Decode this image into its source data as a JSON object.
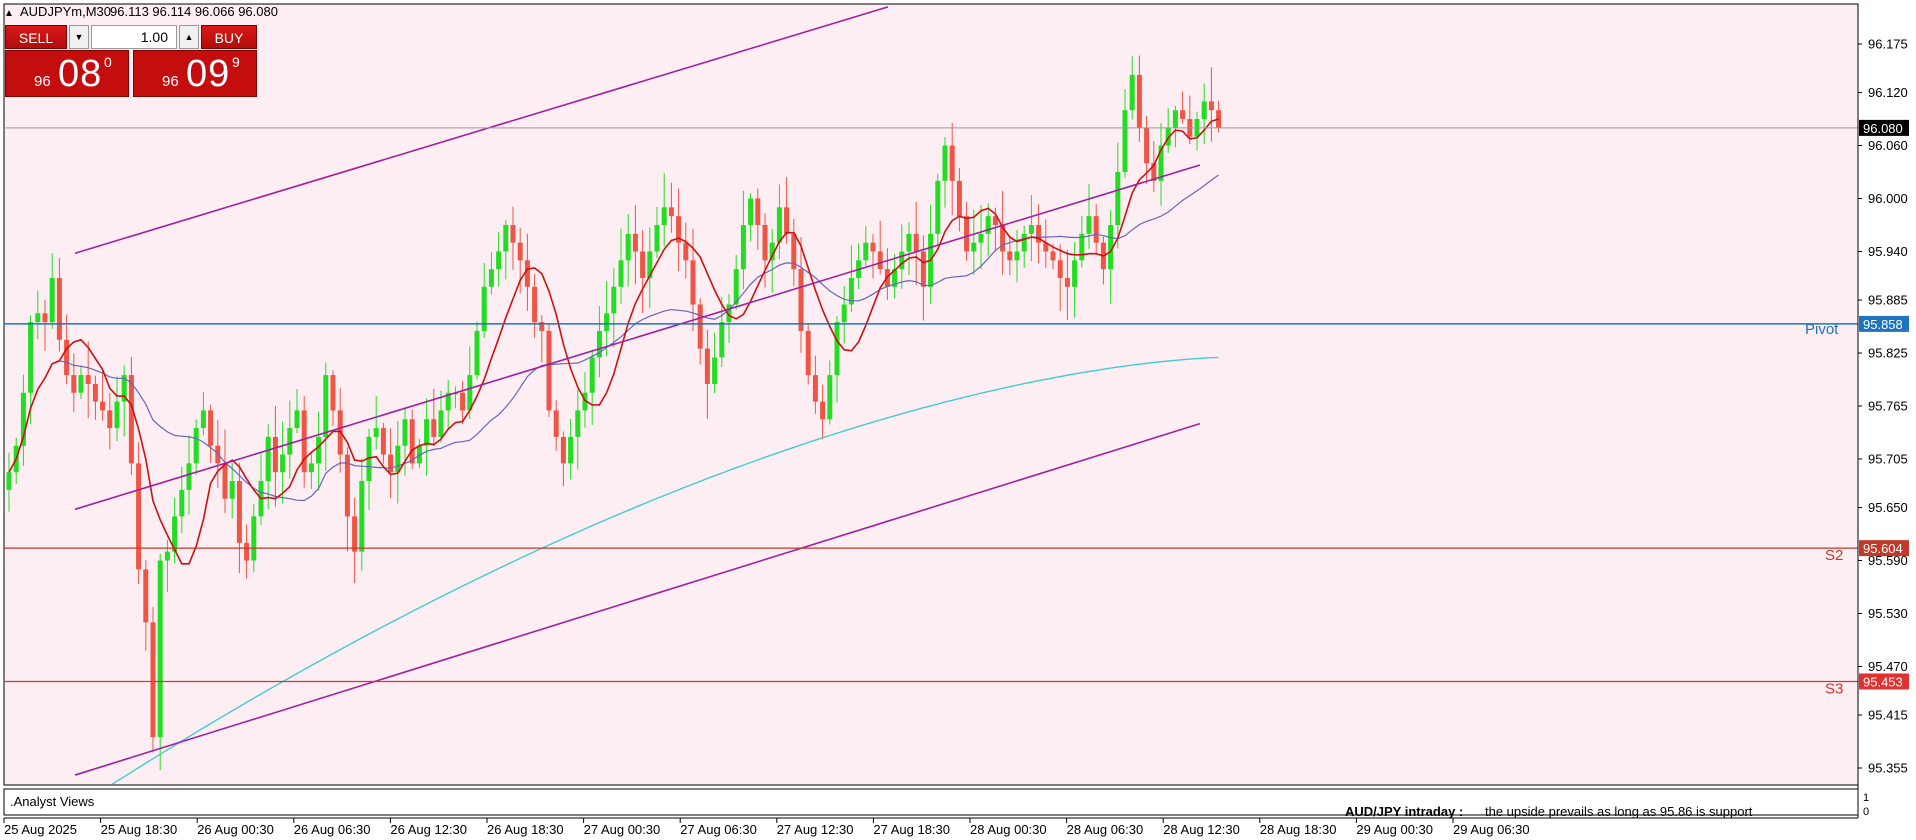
{
  "header": {
    "collapse_glyph": "▲",
    "symbol": "AUDJPYm,M30",
    "ohlc": "96.113 96.114 96.066 96.080"
  },
  "trade_panel": {
    "sell_label": "SELL",
    "buy_label": "BUY",
    "lot": "1.00",
    "sell_price": {
      "big": "96",
      "main": "08",
      "sup": "0"
    },
    "buy_price": {
      "big": "96",
      "main": "09",
      "sup": "9"
    },
    "spin_down_icon": "triangle-down-icon",
    "spin_up_icon": "triangle-up-icon"
  },
  "levels": {
    "pivot": {
      "label": "Pivot",
      "value": "95.858",
      "color": "#1e73be"
    },
    "s2": {
      "label": "S2",
      "value": "95.604",
      "color": "#c0392b"
    },
    "s3": {
      "label": "S3",
      "value": "95.453",
      "color": "#e03030"
    },
    "current": {
      "value": "96.080"
    }
  },
  "indicator_pane": {
    "title": ".Analyst Views",
    "scale_top": "1",
    "scale_bottom": "0",
    "comment_title": "AUD/JPY intraday :",
    "comment_text": "the upside prevails as long as 95.86 is support"
  },
  "chart_data": {
    "type": "candlestick",
    "symbol": "AUDJPYm",
    "timeframe": "M30",
    "ylim": [
      95.31,
      96.22
    ],
    "y_ticks": [
      "96.175",
      "96.120",
      "96.060",
      "96.000",
      "95.940",
      "95.885",
      "95.825",
      "95.765",
      "95.705",
      "95.650",
      "95.590",
      "95.530",
      "95.470",
      "95.415",
      "95.355"
    ],
    "x_ticks": [
      "25 Aug 2025",
      "25 Aug 18:30",
      "26 Aug 00:30",
      "26 Aug 06:30",
      "26 Aug 12:30",
      "26 Aug 18:30",
      "27 Aug 00:30",
      "27 Aug 06:30",
      "27 Aug 12:30",
      "27 Aug 18:30",
      "28 Aug 00:30",
      "28 Aug 06:30",
      "28 Aug 12:30",
      "28 Aug 18:30",
      "29 Aug 00:30",
      "29 Aug 06:30"
    ],
    "colors": {
      "bull": "#22dd22",
      "bear": "#ee5544",
      "background": "#fdeef4",
      "grid": "#c0c0c0",
      "channel": "#a020a0",
      "ma_fast": "#cc1111",
      "ma_mid": "#6666bb",
      "ma_slow": "#44cccc"
    },
    "candle_path": [
      95.69,
      95.72,
      95.78,
      95.86,
      95.87,
      95.86,
      95.91,
      95.84,
      95.8,
      95.78,
      95.8,
      95.79,
      95.77,
      95.76,
      95.74,
      95.77,
      95.8,
      95.7,
      95.58,
      95.52,
      95.39,
      95.59,
      95.6,
      95.64,
      95.67,
      95.7,
      95.74,
      95.76,
      95.72,
      95.7,
      95.66,
      95.68,
      95.61,
      95.59,
      95.64,
      95.68,
      95.73,
      95.69,
      95.71,
      95.74,
      95.76,
      95.69,
      95.7,
      95.73,
      95.8,
      95.76,
      95.71,
      95.64,
      95.6,
      95.68,
      95.73,
      95.74,
      95.71,
      95.69,
      95.72,
      95.75,
      95.7,
      95.72,
      95.75,
      95.73,
      95.76,
      95.78,
      95.78,
      95.76,
      95.8,
      95.85,
      95.9,
      95.92,
      95.94,
      95.97,
      95.95,
      95.93,
      95.9,
      95.86,
      95.85,
      95.76,
      95.73,
      95.7,
      95.73,
      95.76,
      95.78,
      95.82,
      95.85,
      95.87,
      95.9,
      95.93,
      95.96,
      95.94,
      95.91,
      95.94,
      95.97,
      95.99,
      95.98,
      95.95,
      95.93,
      95.88,
      95.83,
      95.79,
      95.82,
      95.86,
      95.88,
      95.92,
      95.97,
      96.0,
      95.97,
      95.93,
      95.95,
      95.99,
      95.96,
      95.92,
      95.85,
      95.8,
      95.77,
      95.75,
      95.8,
      95.86,
      95.88,
      95.91,
      95.93,
      95.95,
      95.94,
      95.92,
      95.9,
      95.92,
      95.94,
      95.96,
      95.94,
      95.9,
      95.96,
      96.02,
      96.06,
      96.02,
      95.98,
      95.94,
      95.95,
      95.96,
      95.98,
      95.97,
      95.94,
      95.93,
      95.94,
      95.96,
      95.97,
      95.95,
      95.94,
      95.93,
      95.91,
      95.9,
      95.93,
      95.96,
      95.98,
      95.95,
      95.92,
      95.97,
      96.03,
      96.1,
      96.14,
      96.08,
      96.04,
      96.02,
      96.06,
      96.08,
      96.1,
      96.09,
      96.07,
      96.09,
      96.11,
      96.1,
      96.08
    ],
    "moving_averages": [
      {
        "period": 20,
        "color": "#cc1111",
        "last": 96.08
      },
      {
        "period": 50,
        "color": "#6666bb",
        "last": 95.98
      },
      {
        "period": 200,
        "color": "#44cccc",
        "last": 95.82
      }
    ],
    "channel": {
      "upper": [
        [
          10,
          95.94
        ],
        [
          110,
          96.22
        ]
      ],
      "middle": [
        [
          10,
          95.67
        ],
        [
          1000000000.0,
          0
        ]
      ],
      "lower": [
        [
          10,
          95.35
        ],
        [
          160,
          95.75
        ]
      ]
    }
  }
}
